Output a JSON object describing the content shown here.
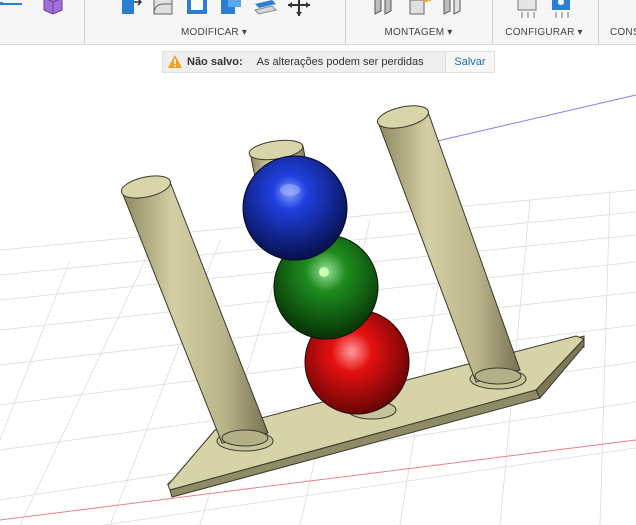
{
  "toolbar": {
    "groups": [
      {
        "label": "MODIFICAR ▾"
      },
      {
        "label": "MONTAGEM ▾"
      },
      {
        "label": "CONFIGURAR ▾"
      },
      {
        "label": "CONS"
      }
    ]
  },
  "notice": {
    "status": "Não salvo:",
    "message": "As alterações podem ser perdidas",
    "save_label": "Salvar"
  },
  "colors": {
    "accent": "#1a6fb5",
    "warning": "#f0a020",
    "rod": "#c9c49a",
    "base": "#d6d2a8",
    "ball_blue": "#1030c8",
    "ball_green": "#1a8a1a",
    "ball_red": "#e01010"
  }
}
